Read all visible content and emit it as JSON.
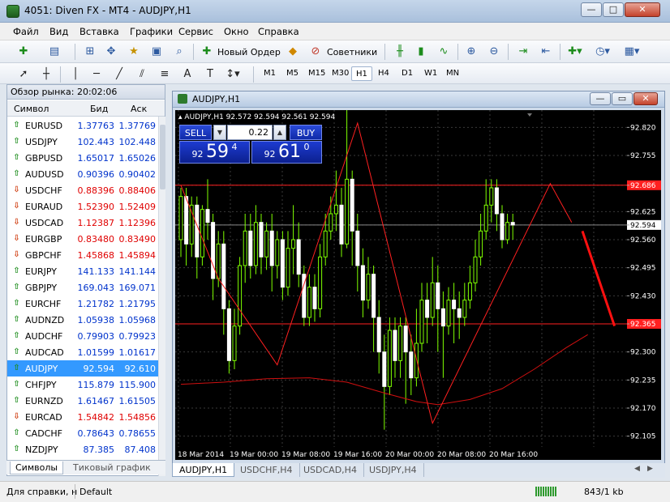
{
  "window": {
    "title": "4051: Diven FX - MT4 - AUDJPY,H1"
  },
  "menu": [
    "Файл",
    "Вид",
    "Вставка",
    "Графики",
    "Сервис",
    "Окно",
    "Справка"
  ],
  "toolbar": {
    "new_order": "Новый Ордер",
    "experts": "Советники"
  },
  "timeframes": [
    "M1",
    "M5",
    "M15",
    "M30",
    "H1",
    "H4",
    "D1",
    "W1",
    "MN"
  ],
  "active_timeframe": "H1",
  "market_watch": {
    "title": "Обзор рынка: 20:02:06",
    "columns": {
      "symbol": "Символ",
      "bid": "Бид",
      "ask": "Аск"
    },
    "rows": [
      {
        "symbol": "EURUSD",
        "bid": "1.37763",
        "ask": "1.37769",
        "dir": "up"
      },
      {
        "symbol": "USDJPY",
        "bid": "102.443",
        "ask": "102.448",
        "dir": "up"
      },
      {
        "symbol": "GBPUSD",
        "bid": "1.65017",
        "ask": "1.65026",
        "dir": "up"
      },
      {
        "symbol": "AUDUSD",
        "bid": "0.90396",
        "ask": "0.90402",
        "dir": "up"
      },
      {
        "symbol": "USDCHF",
        "bid": "0.88396",
        "ask": "0.88406",
        "dir": "down"
      },
      {
        "symbol": "EURAUD",
        "bid": "1.52390",
        "ask": "1.52409",
        "dir": "down"
      },
      {
        "symbol": "USDCAD",
        "bid": "1.12387",
        "ask": "1.12396",
        "dir": "down"
      },
      {
        "symbol": "EURGBP",
        "bid": "0.83480",
        "ask": "0.83490",
        "dir": "down"
      },
      {
        "symbol": "GBPCHF",
        "bid": "1.45868",
        "ask": "1.45894",
        "dir": "down"
      },
      {
        "symbol": "EURJPY",
        "bid": "141.133",
        "ask": "141.144",
        "dir": "up"
      },
      {
        "symbol": "GBPJPY",
        "bid": "169.043",
        "ask": "169.071",
        "dir": "up"
      },
      {
        "symbol": "EURCHF",
        "bid": "1.21782",
        "ask": "1.21795",
        "dir": "up"
      },
      {
        "symbol": "AUDNZD",
        "bid": "1.05938",
        "ask": "1.05968",
        "dir": "up"
      },
      {
        "symbol": "AUDCHF",
        "bid": "0.79903",
        "ask": "0.79923",
        "dir": "up"
      },
      {
        "symbol": "AUDCAD",
        "bid": "1.01599",
        "ask": "1.01617",
        "dir": "up"
      },
      {
        "symbol": "AUDJPY",
        "bid": "92.594",
        "ask": "92.610",
        "dir": "up",
        "selected": true
      },
      {
        "symbol": "CHFJPY",
        "bid": "115.879",
        "ask": "115.900",
        "dir": "up"
      },
      {
        "symbol": "EURNZD",
        "bid": "1.61467",
        "ask": "1.61505",
        "dir": "up"
      },
      {
        "symbol": "EURCAD",
        "bid": "1.54842",
        "ask": "1.54856",
        "dir": "down"
      },
      {
        "symbol": "CADCHF",
        "bid": "0.78643",
        "ask": "0.78655",
        "dir": "up"
      },
      {
        "symbol": "NZDJPY",
        "bid": "87.385",
        "ask": "87.408",
        "dir": "up"
      }
    ],
    "tabs": [
      "Символы",
      "Тиковый график"
    ]
  },
  "chart_window": {
    "title": "AUDJPY,H1",
    "info": "AUDJPY,H1  92.572 92.594 92.561 92.594",
    "one_click": {
      "sell": "SELL",
      "buy": "BUY",
      "lot": "0.22",
      "sell_prefix": "92",
      "sell_big": "59",
      "sell_sup": "4",
      "buy_prefix": "92",
      "buy_big": "61",
      "buy_sup": "0"
    },
    "tabs": [
      "AUDJPY,H1",
      "USDCHF,H4",
      "USDCAD,H4",
      "USDJPY,H4"
    ],
    "price_labels": [
      "92.820",
      "92.755",
      "92.686",
      "92.625",
      "92.594",
      "92.560",
      "92.495",
      "92.430",
      "92.365",
      "92.300",
      "92.235",
      "92.170",
      "92.105"
    ],
    "time_labels": [
      "18 Mar 2014",
      "19 Mar 00:00",
      "19 Mar 08:00",
      "19 Mar 16:00",
      "20 Mar 00:00",
      "20 Mar 08:00",
      "20 Mar 16:00"
    ]
  },
  "chart_data": {
    "type": "candlestick",
    "title": "AUDJPY,H1",
    "ylim": [
      92.08,
      92.86
    ],
    "current_price": 92.594,
    "hlines": [
      92.686,
      92.365
    ],
    "candles": [
      [
        92.56,
        92.66,
        92.68,
        92.52
      ],
      [
        92.66,
        92.55,
        92.68,
        92.5
      ],
      [
        92.55,
        92.64,
        92.66,
        92.52
      ],
      [
        92.64,
        92.52,
        92.66,
        92.47
      ],
      [
        92.52,
        92.63,
        92.64,
        92.5
      ],
      [
        92.63,
        92.6,
        92.7,
        92.56
      ],
      [
        92.6,
        92.47,
        92.62,
        92.42
      ],
      [
        92.47,
        92.55,
        92.58,
        92.45
      ],
      [
        92.55,
        92.4,
        92.58,
        92.34
      ],
      [
        92.4,
        92.28,
        92.42,
        92.25
      ],
      [
        92.28,
        92.36,
        92.4,
        92.26
      ],
      [
        92.36,
        92.5,
        92.52,
        92.34
      ],
      [
        92.5,
        92.58,
        92.62,
        92.46
      ],
      [
        92.58,
        92.5,
        92.62,
        92.47
      ],
      [
        92.5,
        92.6,
        92.64,
        92.48
      ],
      [
        92.6,
        92.52,
        92.62,
        92.48
      ],
      [
        92.52,
        92.58,
        92.6,
        92.49
      ],
      [
        92.58,
        92.5,
        92.62,
        92.44
      ],
      [
        92.5,
        92.56,
        92.58,
        92.47
      ],
      [
        92.56,
        92.45,
        92.58,
        92.42
      ],
      [
        92.45,
        92.54,
        92.58,
        92.43
      ],
      [
        92.54,
        92.56,
        92.64,
        92.48
      ],
      [
        92.56,
        92.48,
        92.6,
        92.45
      ],
      [
        92.48,
        92.38,
        92.5,
        92.36
      ],
      [
        92.38,
        92.45,
        92.48,
        92.36
      ],
      [
        92.45,
        92.4,
        92.48,
        92.37
      ],
      [
        92.4,
        92.52,
        92.55,
        92.38
      ],
      [
        92.52,
        92.58,
        92.62,
        92.5
      ],
      [
        92.58,
        92.62,
        92.66,
        92.56
      ],
      [
        92.62,
        92.64,
        92.72,
        92.58
      ],
      [
        92.64,
        92.55,
        92.68,
        92.52
      ],
      [
        92.55,
        92.7,
        92.86,
        92.54
      ],
      [
        92.7,
        92.58,
        92.72,
        92.5
      ],
      [
        92.58,
        92.5,
        92.62,
        92.44
      ],
      [
        92.5,
        92.42,
        92.54,
        92.38
      ],
      [
        92.42,
        92.48,
        92.52,
        92.4
      ],
      [
        92.48,
        92.38,
        92.5,
        92.3
      ],
      [
        92.38,
        92.3,
        92.42,
        92.25
      ],
      [
        92.3,
        92.22,
        92.34,
        92.12
      ],
      [
        92.22,
        92.35,
        92.38,
        92.2
      ],
      [
        92.35,
        92.28,
        92.38,
        92.24
      ],
      [
        92.28,
        92.36,
        92.38,
        92.24
      ],
      [
        92.36,
        92.3,
        92.38,
        92.18
      ],
      [
        92.3,
        92.24,
        92.34,
        92.2
      ],
      [
        92.24,
        92.32,
        92.4,
        92.22
      ],
      [
        92.32,
        92.42,
        92.46,
        92.3
      ],
      [
        92.42,
        92.38,
        92.46,
        92.32
      ],
      [
        92.38,
        92.46,
        92.52,
        92.36
      ],
      [
        92.46,
        92.4,
        92.5,
        92.3
      ],
      [
        92.4,
        92.36,
        92.44,
        92.24
      ],
      [
        92.36,
        92.42,
        92.45,
        92.34
      ],
      [
        92.42,
        92.4,
        92.46,
        92.32
      ],
      [
        92.4,
        92.38,
        92.44,
        92.33
      ],
      [
        92.38,
        92.42,
        92.46,
        92.36
      ],
      [
        92.42,
        92.46,
        92.5,
        92.4
      ],
      [
        92.46,
        92.52,
        92.56,
        92.44
      ],
      [
        92.52,
        92.58,
        92.62,
        92.5
      ],
      [
        92.58,
        92.64,
        92.7,
        92.56
      ],
      [
        92.64,
        92.68,
        92.7,
        92.6
      ],
      [
        92.68,
        92.62,
        92.7,
        92.58
      ],
      [
        92.62,
        92.56,
        92.64,
        92.54
      ],
      [
        92.56,
        92.6,
        92.62,
        92.55
      ],
      [
        92.6,
        92.594,
        92.62,
        92.56
      ]
    ],
    "zigzag": [
      [
        0,
        92.686
      ],
      [
        7,
        92.47
      ],
      [
        18,
        92.27
      ],
      [
        33,
        92.83
      ],
      [
        47,
        92.135
      ],
      [
        69,
        92.69
      ],
      [
        73,
        92.6
      ]
    ],
    "moving_average": [
      [
        0,
        92.225
      ],
      [
        8,
        92.23
      ],
      [
        16,
        92.238
      ],
      [
        24,
        92.24
      ],
      [
        31,
        92.23
      ],
      [
        38,
        92.205
      ],
      [
        44,
        92.185
      ],
      [
        48,
        92.178
      ],
      [
        54,
        92.19
      ],
      [
        60,
        92.215
      ],
      [
        66,
        92.26
      ],
      [
        72,
        92.31
      ],
      [
        76,
        92.34
      ]
    ],
    "arrow": {
      "from": [
        75,
        92.58
      ],
      "to": [
        81,
        92.36
      ]
    }
  },
  "status": {
    "help": "Для справки, н",
    "profile": "Default",
    "traffic": "843/1 kb"
  },
  "colors": {
    "accent": "#3399ff",
    "chart_bg": "#000000",
    "bull": "#7fff00",
    "bear": "#ffffff",
    "grid": "#333333",
    "zigzag": "#ff0000"
  }
}
